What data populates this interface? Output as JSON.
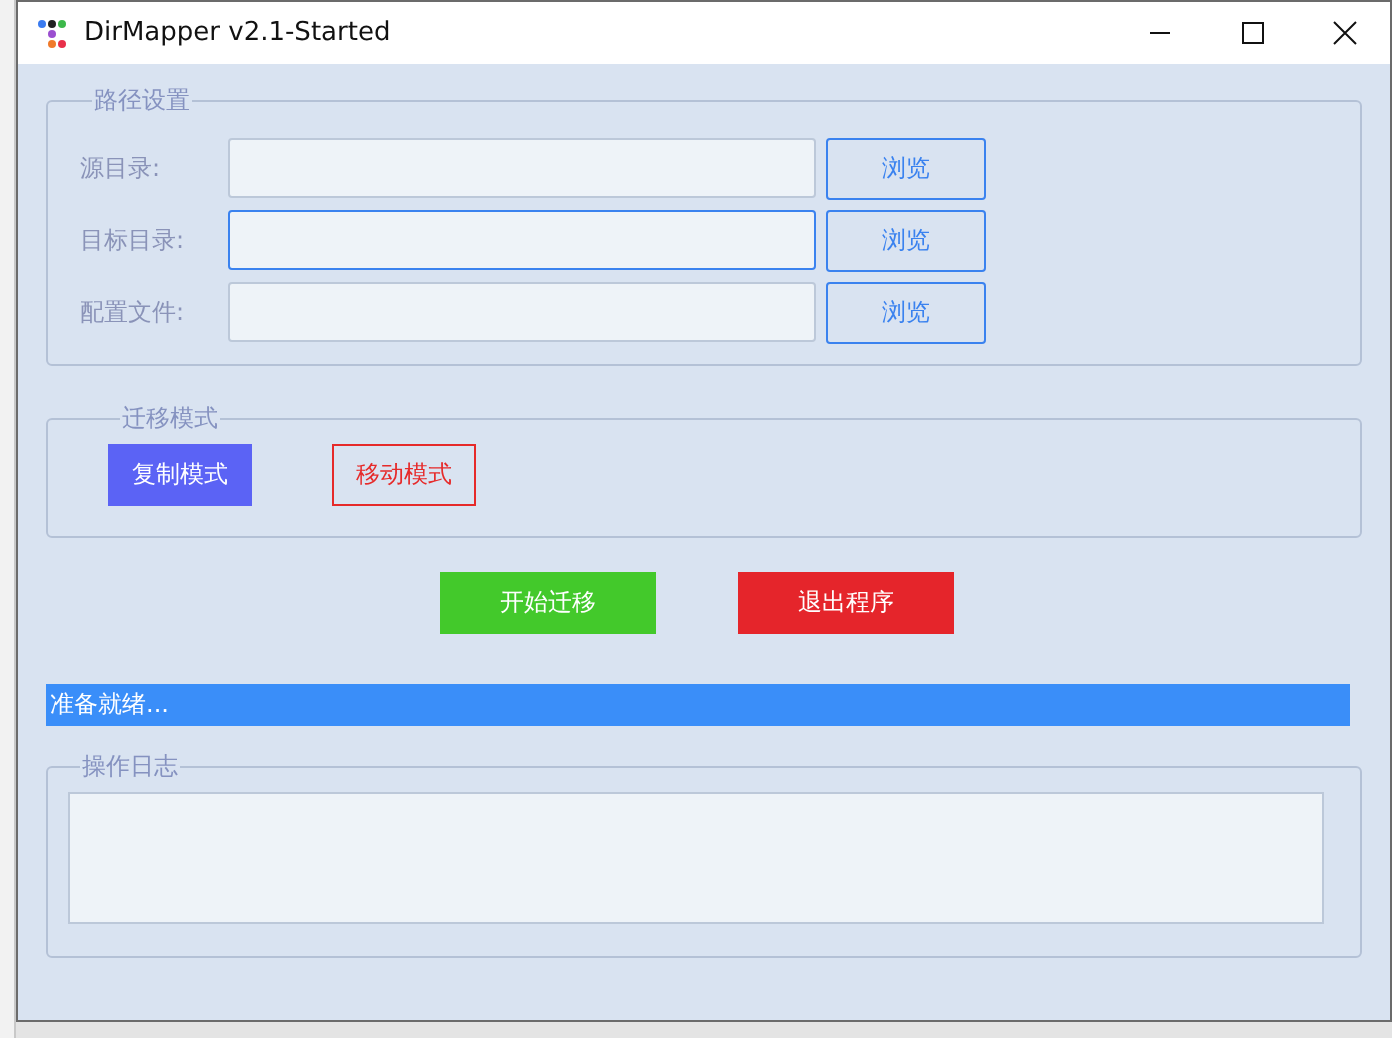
{
  "window": {
    "title": "DirMapper v2.1-Started"
  },
  "path_settings": {
    "title": "路径设置",
    "rows": [
      {
        "label": "源目录:",
        "focused": false,
        "button": "浏览"
      },
      {
        "label": "目标目录:",
        "focused": true,
        "button": "浏览"
      },
      {
        "label": "配置文件:",
        "focused": false,
        "button": "浏览"
      }
    ]
  },
  "migration_mode": {
    "title": "迁移模式",
    "modes": [
      {
        "label": "复制模式",
        "selected": true,
        "color": "#5b63f5"
      },
      {
        "label": "移动模式",
        "selected": false,
        "color": "#e62a2a"
      }
    ]
  },
  "actions": [
    {
      "label": "开始迁移",
      "color": "#43c92b"
    },
    {
      "label": "退出程序",
      "color": "#e5252b"
    }
  ],
  "status_bar": "准备就绪...",
  "log": {
    "title": "操作日志"
  }
}
